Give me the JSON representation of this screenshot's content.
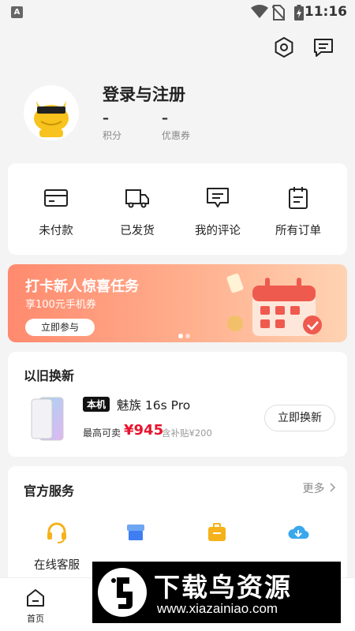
{
  "status_bar": {
    "time": "11:16",
    "app_icon_letter": "A"
  },
  "header": {
    "icons": [
      "settings-hexagon-icon",
      "message-icon"
    ]
  },
  "profile": {
    "name": "登录与注册",
    "points_value": "–",
    "points_label": "积分",
    "coupons_value": "–",
    "coupons_label": "优惠券"
  },
  "orders": [
    {
      "label": "未付款",
      "icon": "card-icon"
    },
    {
      "label": "已发货",
      "icon": "truck-icon"
    },
    {
      "label": "我的评论",
      "icon": "comment-icon"
    },
    {
      "label": "所有订单",
      "icon": "clipboard-icon"
    }
  ],
  "banner": {
    "title": "打卡新人惊喜任务",
    "subtitle": "享100元手机券",
    "button": "立即参与",
    "page_count": 2,
    "active_page": 1
  },
  "trade_in": {
    "title": "以旧换新",
    "tag": "本机",
    "model": "魅族 16s Pro",
    "price_label": "最高可卖",
    "price": "¥945",
    "subsidy": "含补贴¥200",
    "button": "立即换新"
  },
  "services": {
    "title": "官方服务",
    "more": "更多",
    "items": [
      {
        "label": "在线客服",
        "icon": "headset-icon"
      }
    ]
  },
  "tab_bar": {
    "home_label": "首页"
  },
  "watermark": {
    "text": "下载鸟资源",
    "url": "www.xiazainiao.com"
  },
  "colors": {
    "price_red": "#e8132d",
    "banner_start": "#ff8a6e",
    "banner_end": "#ffd3b3"
  }
}
